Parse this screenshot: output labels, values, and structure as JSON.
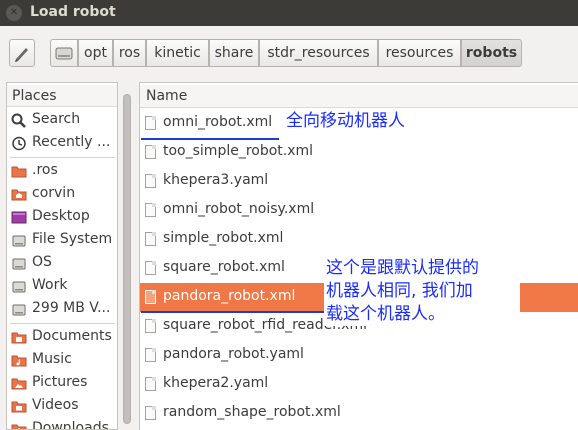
{
  "window": {
    "title": "Load robot"
  },
  "toolbar": {
    "breadcrumbs": [
      "opt",
      "ros",
      "kinetic",
      "share",
      "stdr_resources",
      "resources",
      "robots"
    ]
  },
  "sidebar": {
    "header": "Places",
    "items": [
      {
        "label": "Search",
        "icon": "search-icon"
      },
      {
        "label": "Recently ...",
        "icon": "recent-icon"
      },
      {
        "label": ".ros",
        "icon": "folder-icon"
      },
      {
        "label": "corvin",
        "icon": "home-folder-icon"
      },
      {
        "label": "Desktop",
        "icon": "desktop-icon"
      },
      {
        "label": "File System",
        "icon": "drive-icon"
      },
      {
        "label": "OS",
        "icon": "drive-icon"
      },
      {
        "label": "Work",
        "icon": "drive-icon"
      },
      {
        "label": "299 MB V...",
        "icon": "drive-icon"
      },
      {
        "label": "Documents",
        "icon": "documents-folder-icon"
      },
      {
        "label": "Music",
        "icon": "music-folder-icon"
      },
      {
        "label": "Pictures",
        "icon": "pictures-folder-icon"
      },
      {
        "label": "Videos",
        "icon": "videos-folder-icon"
      },
      {
        "label": "Downloads",
        "icon": "downloads-folder-icon"
      }
    ]
  },
  "filelist": {
    "header": "Name",
    "files": [
      "omni_robot.xml",
      "too_simple_robot.xml",
      "khepera3.yaml",
      "omni_robot_noisy.xml",
      "simple_robot.xml",
      "square_robot.xml",
      "pandora_robot.xml",
      "square_robot_rfid_reader.xml",
      "pandora_robot.yaml",
      "khepera2.yaml",
      "random_shape_robot.xml"
    ],
    "selected": "pandora_robot.xml"
  },
  "annotations": {
    "note1": "全向移动机器人",
    "note2_line1": "这个是跟默认提供的",
    "note2_line2": "机器人相同, 我们加",
    "note2_line3": "载这个机器人。"
  },
  "colors": {
    "titlebar": "#3c3b37",
    "selection": "#f07746",
    "annotation_text": "#1a2cff"
  }
}
